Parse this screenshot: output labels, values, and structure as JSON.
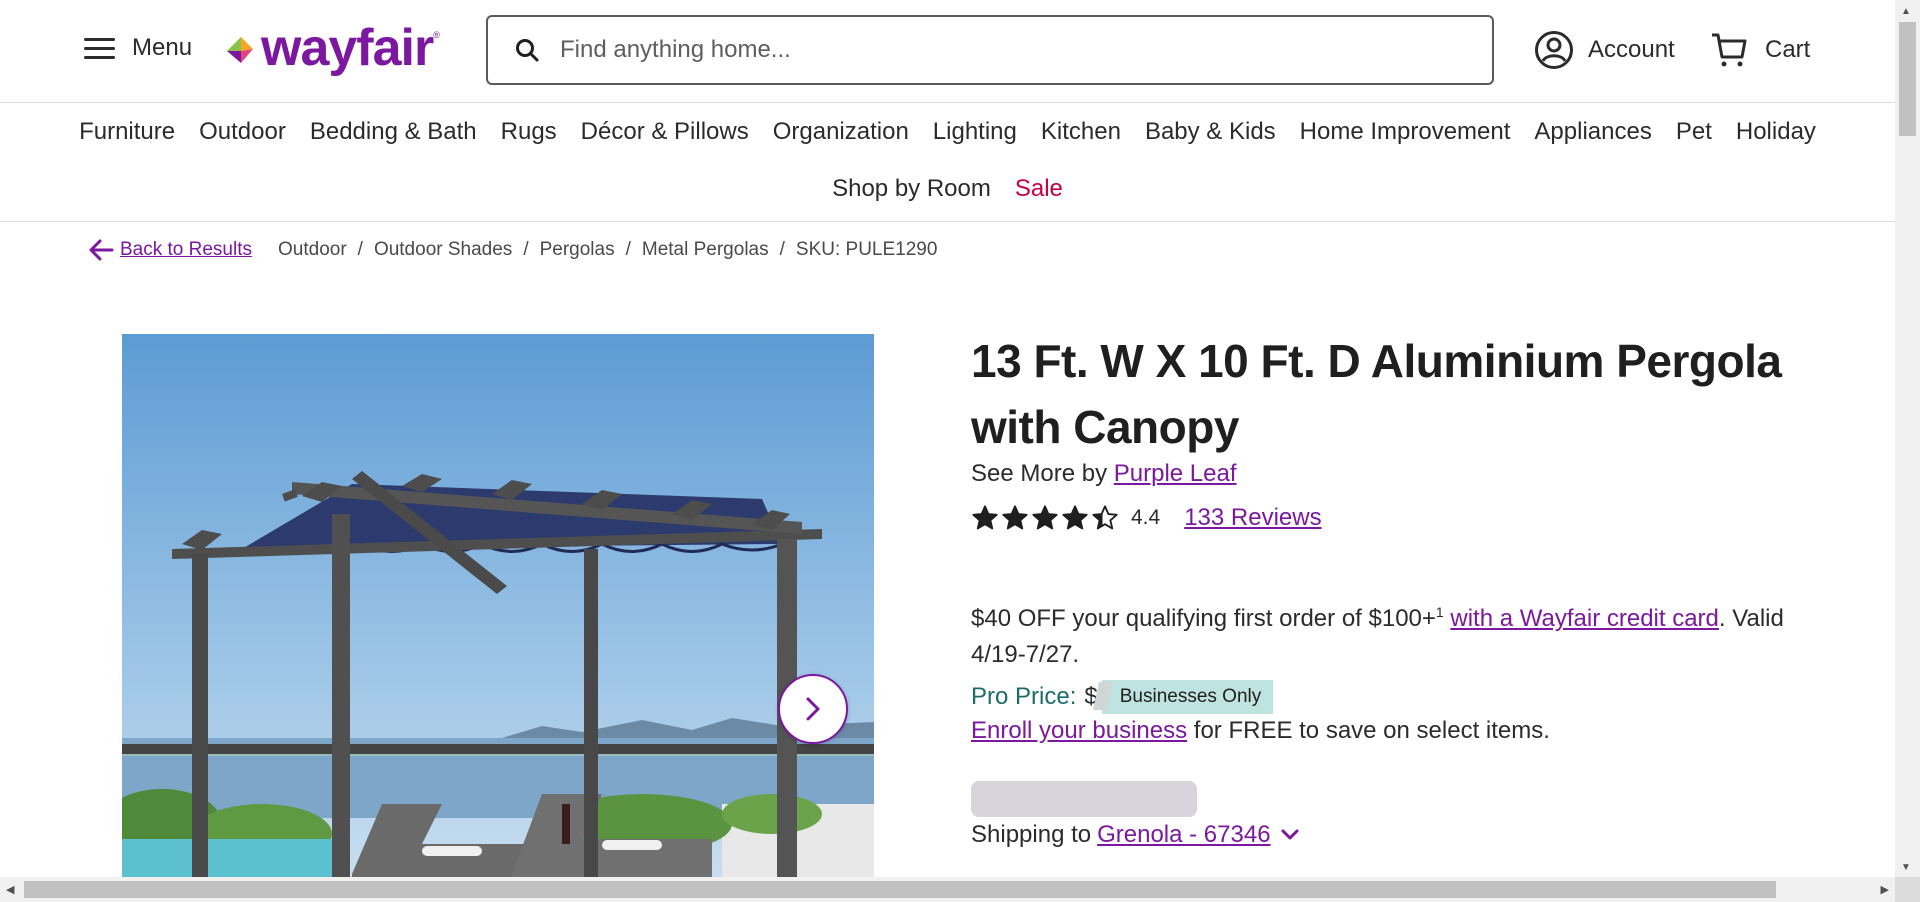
{
  "header": {
    "menu_label": "Menu",
    "logo_text": "wayfair",
    "search_placeholder": "Find anything home...",
    "account_label": "Account",
    "cart_label": "Cart"
  },
  "categories": {
    "row1": [
      "Furniture",
      "Outdoor",
      "Bedding & Bath",
      "Rugs",
      "Décor & Pillows",
      "Organization",
      "Lighting",
      "Kitchen",
      "Baby & Kids",
      "Home Improvement",
      "Appliances",
      "Pet",
      "Holiday"
    ],
    "row2": [
      "Shop by Room",
      "Sale"
    ]
  },
  "breadcrumb": {
    "back": "Back to Results",
    "items": [
      "Outdoor",
      "Outdoor Shades",
      "Pergolas",
      "Metal Pergolas",
      "SKU: PULE1290"
    ]
  },
  "product": {
    "title": "13 Ft. W X 10 Ft. D Aluminium Pergola with Canopy",
    "see_more_prefix": "See More by",
    "brand": "Purple Leaf",
    "rating_value": "4.4",
    "stars": 4.4,
    "reviews": "133 Reviews",
    "promo_text": "$40 OFF your qualifying first order of $100+",
    "promo_sup": "1",
    "promo_link": "with a Wayfair credit card",
    "promo_suffix": ". Valid 4/19-7/27.",
    "pro_label": "Pro Price:",
    "pro_dollar": "$",
    "pro_badge": "Businesses Only",
    "enroll_link": "Enroll your business",
    "enroll_suffix": " for FREE to save on select items.",
    "shipping_prefix": "Shipping to",
    "shipping_location": "Grenola - 67346"
  },
  "colors": {
    "brand": "#7b189f",
    "sale": "#c60041",
    "pro": "#1d6c6a",
    "badge": "#bfe3e0"
  }
}
